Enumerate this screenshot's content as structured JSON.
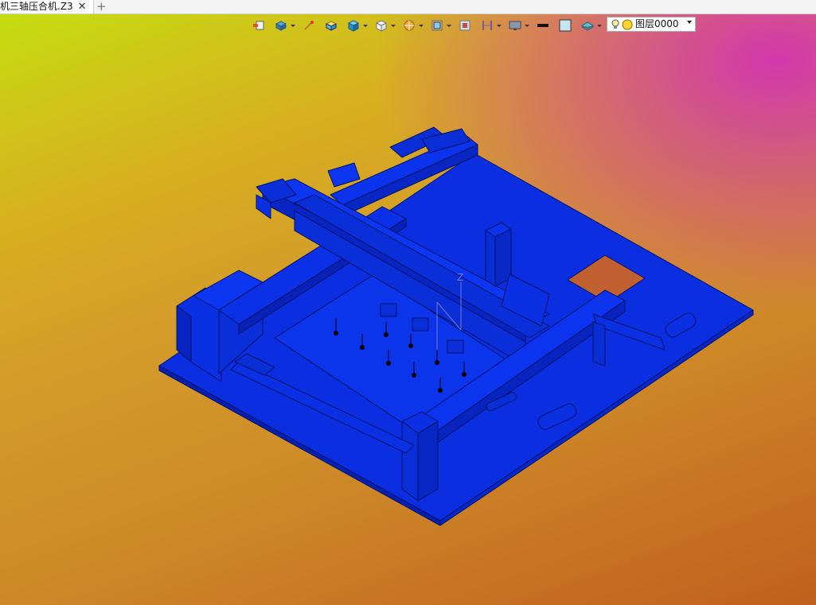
{
  "document_tab": {
    "title": "机三轴压合机.Z3",
    "close_symbol": "✕",
    "new_tab_symbol": "+"
  },
  "toolbar": {
    "icons": [
      "exit-sketch-icon",
      "view-orientation-icon",
      "paint-brush-icon",
      "shaded-solid-icon",
      "cube-face-icon",
      "wire-cube-icon",
      "section-view-icon",
      "zoom-extents-icon",
      "render-mode-icon",
      "display-style-icon",
      "monitor-icon",
      "line-color-swatch",
      "fill-color-swatch",
      "layer-visibility-icon"
    ],
    "line_color": "#111111",
    "fill_color": "#c6e6f6"
  },
  "layer_selector": {
    "current": "图层0000",
    "bulb_color": "#ffd62e"
  },
  "viewport": {
    "model_color": "#0a2ee0",
    "model_edge_color": "#001466",
    "axis_label": "Z",
    "axis_color": "#7878d0"
  }
}
